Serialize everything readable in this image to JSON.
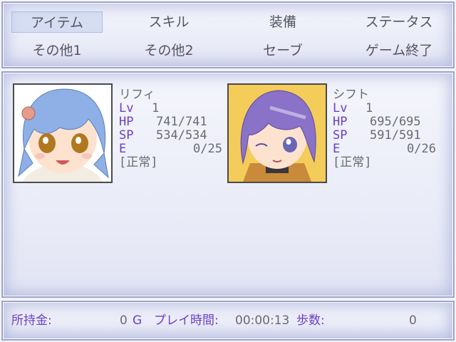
{
  "menu": {
    "items": [
      "アイテム",
      "スキル",
      "装備",
      "ステータス",
      "その他1",
      "その他2",
      "セーブ",
      "ゲーム終了"
    ],
    "selected_index": 0
  },
  "party": [
    {
      "name": "リフィ",
      "lv_label": "Lv",
      "lv": "1",
      "hp_label": "HP",
      "hp": "741/741",
      "sp_label": "SP",
      "sp": "534/534",
      "e_label": "E",
      "e": "0/25",
      "state": "[正常]",
      "hair_color": "#8fb0e6"
    },
    {
      "name": "シフト",
      "lv_label": "Lv",
      "lv": "1",
      "hp_label": "HP",
      "hp": "695/695",
      "sp_label": "SP",
      "sp": "591/591",
      "e_label": "E",
      "e": "0/26",
      "state": "[正常]",
      "hair_color": "#8a72c8"
    }
  ],
  "status_bar": {
    "gold_label": "所持金:",
    "gold_value": "0",
    "gold_unit": "G",
    "time_label": "プレイ時間:",
    "time_value": "00:00:13",
    "steps_label": "歩数:",
    "steps_value": "0"
  },
  "colors": {
    "label_purple": "#6a3fc8",
    "text_gray": "#6a6a72",
    "window_border": "#9aa0c8"
  }
}
